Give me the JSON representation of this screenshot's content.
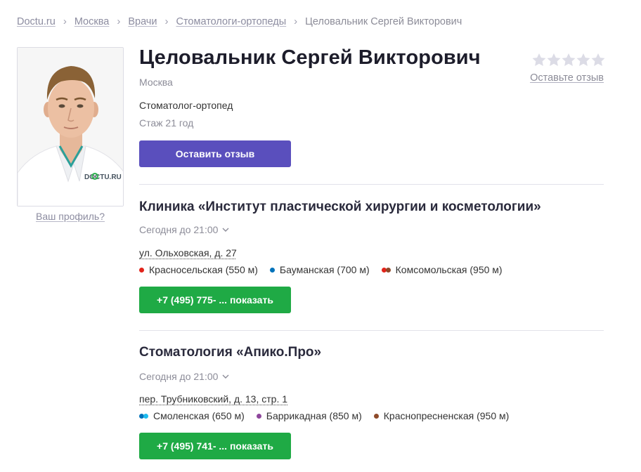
{
  "breadcrumb": {
    "items": [
      "Doctu.ru",
      "Москва",
      "Врачи",
      "Стоматологи-ортопеды"
    ],
    "separator": "›",
    "current": "Целовальник Сергей Викторович"
  },
  "doctor": {
    "name": "Целовальник Сергей Викторович",
    "city": "Москва",
    "specialty": "Стоматолог-ортопед",
    "experience": "Стаж 21 год",
    "photo_watermark": "DOCTU.RU",
    "profile_link": "Ваш профиль?"
  },
  "rating": {
    "stars_total": 5,
    "stars_filled": 0,
    "review_link": "Оставьте отзыв"
  },
  "actions": {
    "leave_review": "Оставить отзыв"
  },
  "clinics": [
    {
      "name": "Клиника «Институт пластической хирургии и косметологии»",
      "hours": "Сегодня до 21:00",
      "address": "ул. Ольховская, д. 27",
      "metro": [
        {
          "name": "Красносельская (550 м)",
          "colors": [
            "#e2231a"
          ]
        },
        {
          "name": "Бауманская (700 м)",
          "colors": [
            "#0072ba"
          ]
        },
        {
          "name": "Комсомольская (950 м)",
          "colors": [
            "#e2231a",
            "#8e4a2a"
          ]
        }
      ],
      "phone_button": "+7 (495) 775- ... показать"
    },
    {
      "name": "Стоматология «Апико.Про»",
      "hours": "Сегодня до 21:00",
      "address": "пер. Трубниковский, д. 13, стр. 1",
      "metro": [
        {
          "name": "Смоленская (650 м)",
          "colors": [
            "#0072ba",
            "#1ebcef"
          ]
        },
        {
          "name": "Баррикадная (850 м)",
          "colors": [
            "#8e479c"
          ]
        },
        {
          "name": "Краснопресненская (950 м)",
          "colors": [
            "#8e4a2a"
          ]
        }
      ],
      "phone_button": "+7 (495) 741- ... показать"
    }
  ],
  "colors": {
    "review_button": "#5a4fbd",
    "phone_button": "#1faa45",
    "star_empty": "#dcdce6",
    "link_gray": "#8c8ca0"
  }
}
